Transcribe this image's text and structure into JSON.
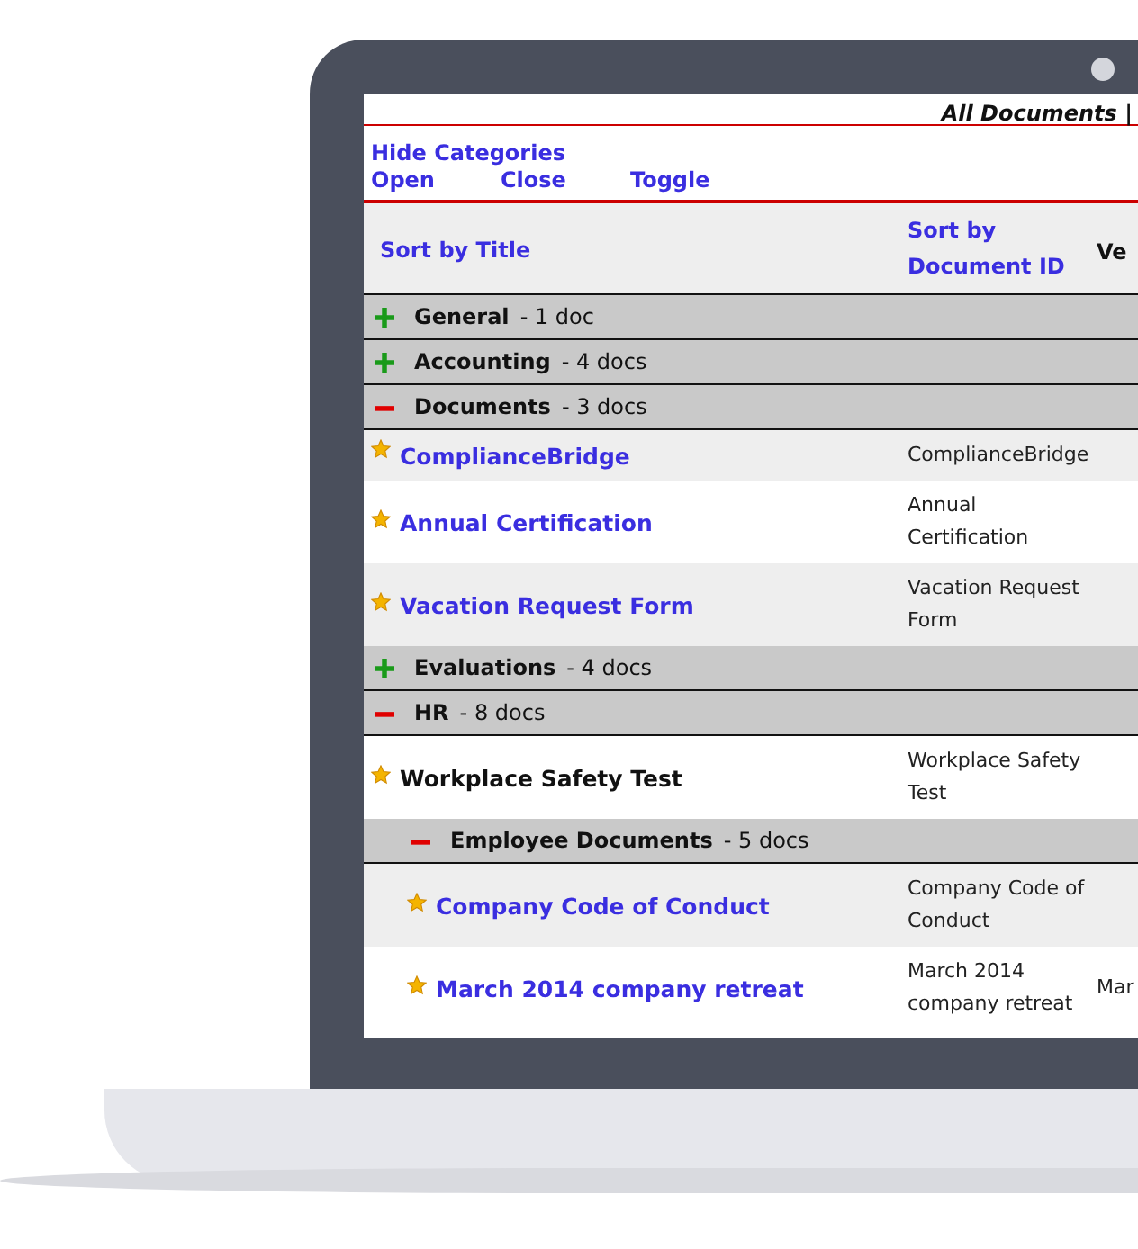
{
  "top_bar": {
    "title": "All Documents |"
  },
  "links": {
    "hide": "Hide Categories",
    "actions": [
      "Open",
      "Close",
      "Toggle"
    ]
  },
  "columns": [
    "Sort by Title",
    "Sort by Document ID",
    "Ve"
  ],
  "categories": [
    {
      "name": "General",
      "count": "- 1 doc",
      "expanded": false
    },
    {
      "name": "Accounting",
      "count": "- 4 docs",
      "expanded": false
    },
    {
      "name": "Documents",
      "count": "- 3 docs",
      "expanded": true,
      "items": [
        {
          "kind": "doc",
          "title": "ComplianceBridge",
          "linked": true,
          "doc_id": "ComplianceBridge"
        },
        {
          "kind": "doc",
          "title": "Annual Certification",
          "linked": true,
          "doc_id": "Annual Certification"
        },
        {
          "kind": "doc",
          "title": "Vacation Request Form",
          "linked": true,
          "doc_id": "Vacation Request Form"
        }
      ]
    },
    {
      "name": "Evaluations",
      "count": "- 4 docs",
      "expanded": false
    },
    {
      "name": "HR",
      "count": "- 8 docs",
      "expanded": true,
      "items": [
        {
          "kind": "doc",
          "title": "Workplace Safety Test",
          "linked": false,
          "doc_id": "Workplace Safety Test"
        },
        {
          "kind": "category",
          "name": "Employee Documents",
          "count": "- 5 docs",
          "expanded": true,
          "items": [
            {
              "kind": "doc",
              "title": "Company Code of Conduct",
              "linked": true,
              "doc_id": "Company Code of Conduct"
            },
            {
              "kind": "doc",
              "title": "March 2014 company retreat",
              "linked": true,
              "doc_id": "March 2014 company retreat",
              "column_3": "Mar"
            }
          ]
        }
      ]
    }
  ]
}
